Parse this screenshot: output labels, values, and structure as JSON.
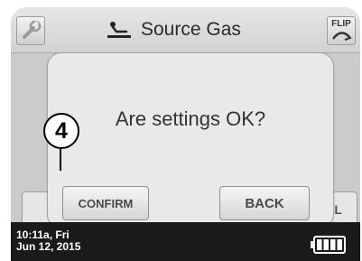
{
  "header": {
    "title": "Source Gas",
    "left_icon": "wrench-icon",
    "title_icon": "gas-source-icon",
    "flip_label": "FLIP",
    "flip_icon": "flip-arrow-icon"
  },
  "background": {
    "partial_button_right_label": "EL"
  },
  "dialog": {
    "message": "Are settings OK?",
    "confirm_label": "CONFIRM",
    "back_label": "BACK"
  },
  "callout": {
    "number": "4"
  },
  "status": {
    "time": "10:11a, Fri",
    "date": "Jun 12, 2015",
    "battery_icon": "battery-icon",
    "battery_level": 1.0
  },
  "colors": {
    "screen_bg": "#c9c9c9",
    "statusbar_bg": "#1a1a1a",
    "dialog_bg": "#e9e9e9"
  }
}
